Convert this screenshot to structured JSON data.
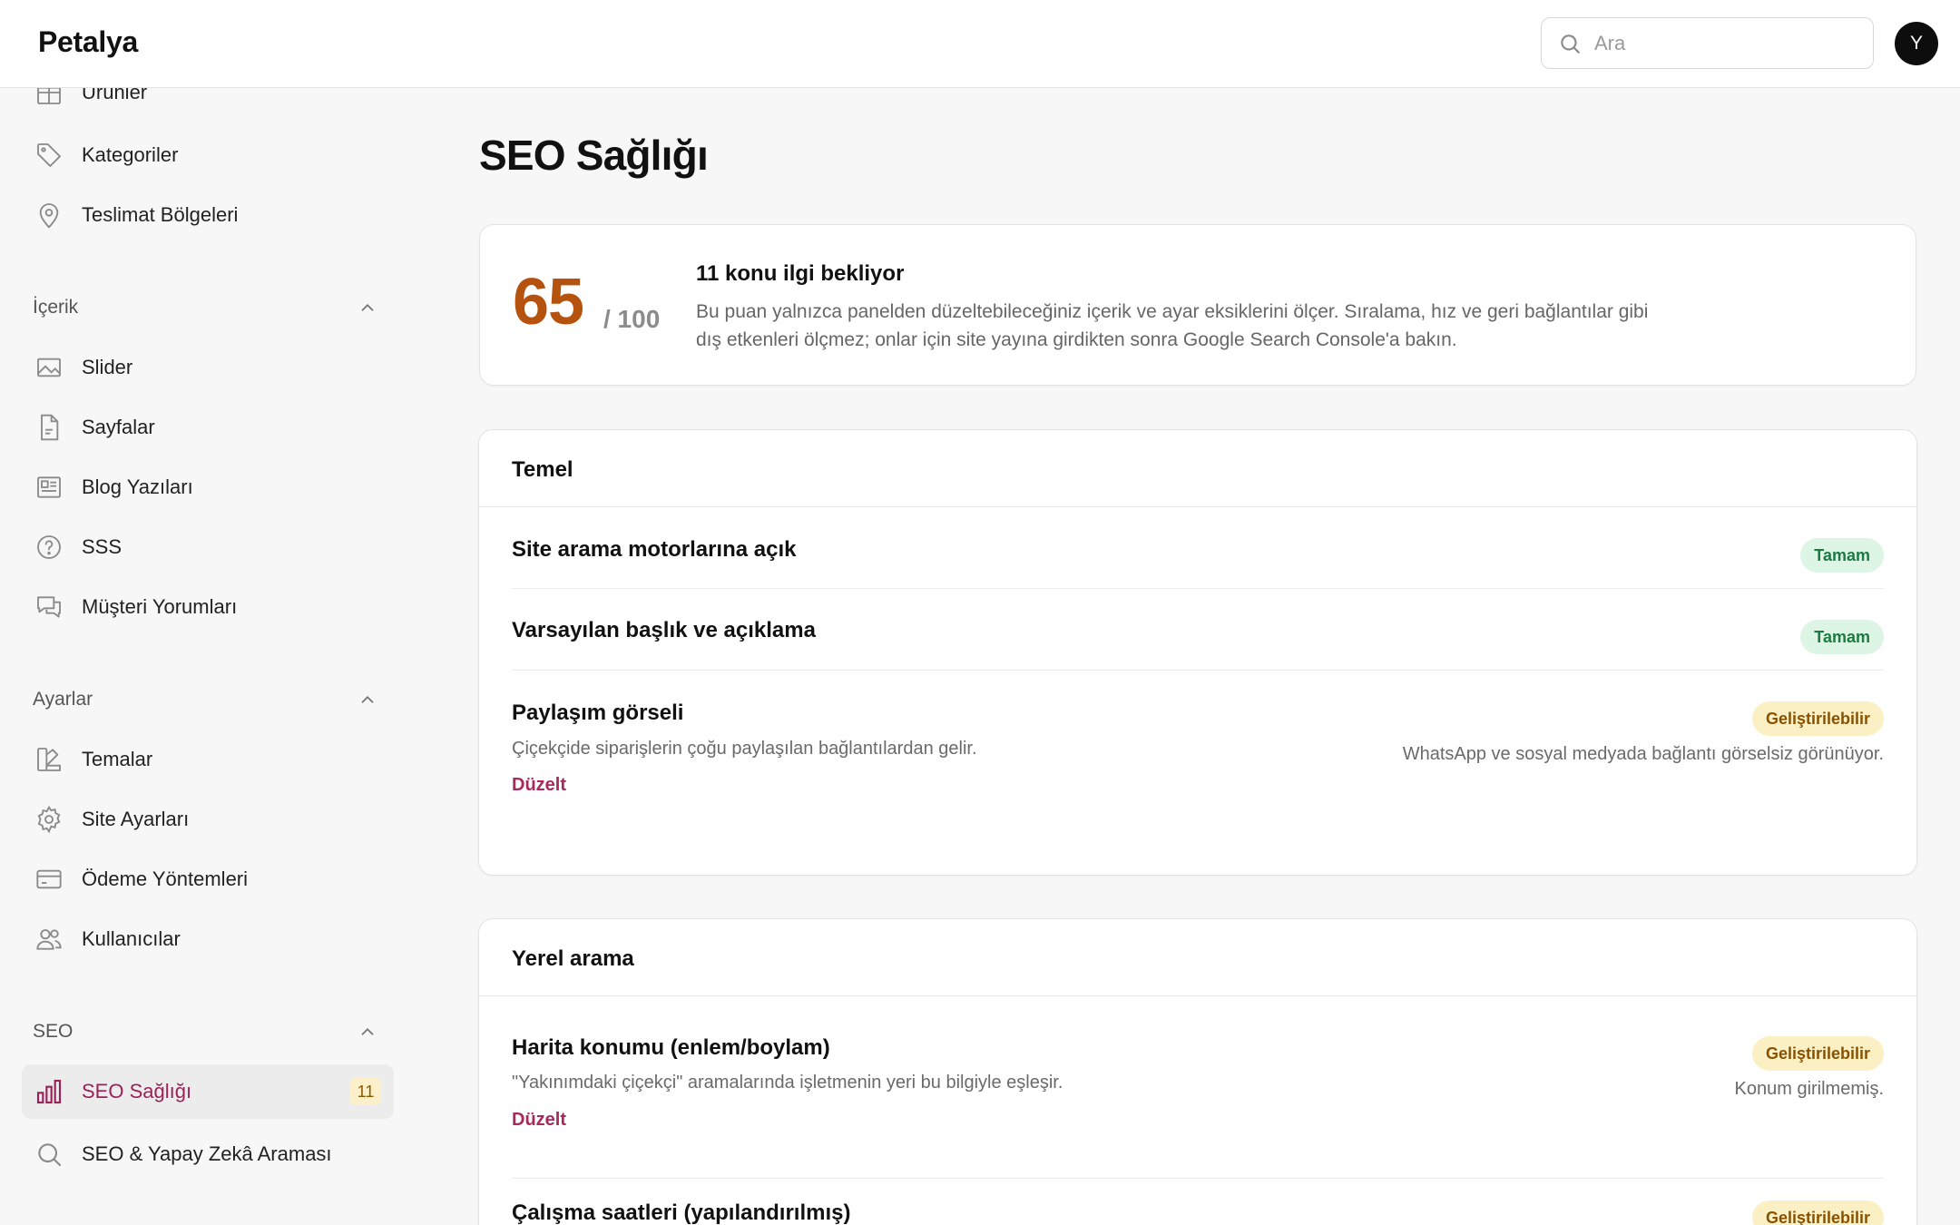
{
  "header": {
    "brand": "Petalya",
    "search_placeholder": "Ara",
    "avatar_initial": "Y"
  },
  "sidebar": {
    "top_items": [
      {
        "label": "Ürünler",
        "icon": "box-icon"
      },
      {
        "label": "Kategoriler",
        "icon": "tag-icon"
      },
      {
        "label": "Teslimat Bölgeleri",
        "icon": "map-pin-icon"
      }
    ],
    "sections": [
      {
        "title": "İçerik",
        "items": [
          {
            "label": "Slider",
            "icon": "image-icon"
          },
          {
            "label": "Sayfalar",
            "icon": "file-icon"
          },
          {
            "label": "Blog Yazıları",
            "icon": "newspaper-icon"
          },
          {
            "label": "SSS",
            "icon": "help-circle-icon"
          },
          {
            "label": "Müşteri Yorumları",
            "icon": "chat-icon"
          }
        ]
      },
      {
        "title": "Ayarlar",
        "items": [
          {
            "label": "Temalar",
            "icon": "palette-icon"
          },
          {
            "label": "Site Ayarları",
            "icon": "gear-icon"
          },
          {
            "label": "Ödeme Yöntemleri",
            "icon": "credit-card-icon"
          },
          {
            "label": "Kullanıcılar",
            "icon": "users-icon"
          }
        ]
      },
      {
        "title": "SEO",
        "items": [
          {
            "label": "SEO Sağlığı",
            "icon": "bar-chart-icon",
            "active": true,
            "badge": "11"
          },
          {
            "label": "SEO & Yapay Zekâ Araması",
            "icon": "search-icon"
          }
        ]
      }
    ]
  },
  "main": {
    "title": "SEO Sağlığı",
    "score": {
      "value": "65",
      "max": "/ 100",
      "heading": "11 konu ilgi bekliyor",
      "description": "Bu puan yalnızca panelden düzeltebileceğiniz içerik ve ayar eksiklerini ölçer. Sıralama, hız ve geri bağlantılar gibi dış etkenleri ölçmez; onlar için site yayına girdikten sonra Google Search Console'a bakın."
    },
    "groups": [
      {
        "title": "Temel",
        "checks": [
          {
            "title": "Site arama motorlarına açık",
            "status": "Tamam",
            "status_kind": "ok"
          },
          {
            "title": "Varsayılan başlık ve açıklama",
            "status": "Tamam",
            "status_kind": "ok"
          },
          {
            "title": "Paylaşım görseli",
            "status": "Geliştirilebilir",
            "status_kind": "warn",
            "description": "Çiçekçide siparişlerin çoğu paylaşılan bağlantılardan gelir.",
            "note": "WhatsApp ve sosyal medyada bağlantı görselsiz görünüyor.",
            "action": "Düzelt"
          }
        ]
      },
      {
        "title": "Yerel arama",
        "checks": [
          {
            "title": "Harita konumu (enlem/boylam)",
            "status": "Geliştirilebilir",
            "status_kind": "warn",
            "description": "\"Yakınımdaki çiçekçi\" aramalarında işletmenin yeri bu bilgiyle eşleşir.",
            "note": "Konum girilmemiş.",
            "action": "Düzelt"
          },
          {
            "title": "Çalışma saatleri (yapılandırılmış)",
            "status": "Geliştirilebilir",
            "status_kind": "warn"
          }
        ]
      }
    ]
  }
}
